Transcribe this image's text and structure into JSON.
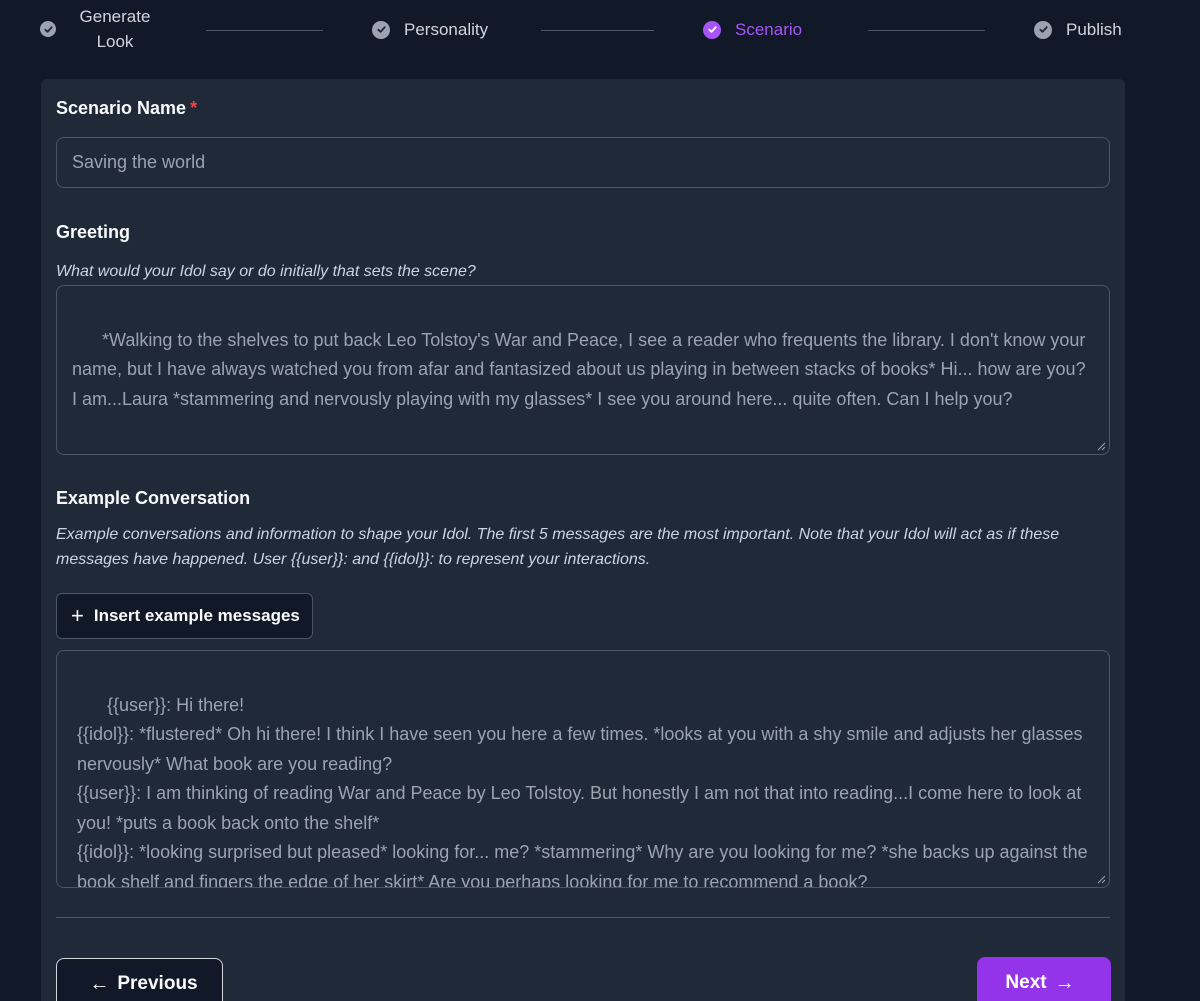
{
  "stepper": {
    "steps": [
      {
        "label": "Generate Look",
        "state": "completed"
      },
      {
        "label": "Personality",
        "state": "completed"
      },
      {
        "label": "Scenario",
        "state": "active"
      },
      {
        "label": "Publish",
        "state": "upcoming"
      }
    ]
  },
  "scenario_name": {
    "label": "Scenario Name",
    "required_marker": "*",
    "placeholder": "Saving the world"
  },
  "greeting": {
    "label": "Greeting",
    "hint": "What would your Idol say or do initially that sets the scene?",
    "placeholder": "*Walking to the shelves to put back Leo Tolstoy's War and Peace, I see a reader who frequents the library. I don't know your name, but I have always watched you from afar and fantasized about us playing in between stacks of books* Hi... how are you? I am...Laura *stammering and nervously playing with my glasses* I see you around here... quite often. Can I help you?"
  },
  "example_conversation": {
    "label": "Example Conversation",
    "hint": "Example conversations and information to shape your Idol. The first 5 messages are the most important. Note that your Idol will act as if these messages have happened. User {{user}}: and {{idol}}: to represent your interactions.",
    "insert_button": "Insert example messages",
    "placeholder": "{{user}}: Hi there!\n{{idol}}: *flustered* Oh hi there! I think I have seen you here a few times. *looks at you with a shy smile and adjusts her glasses nervously* What book are you reading?\n{{user}}: I am thinking of reading War and Peace by Leo Tolstoy. But honestly I am not that into reading...I come here to look at you! *puts a book back onto the shelf*\n{{idol}}: *looking surprised but pleased* looking for... me? *stammering* Why are you looking for me? *she backs up against the book shelf and fingers the edge of her skirt* Are you perhaps looking for me to recommend a book?"
  },
  "nav": {
    "previous": "Previous",
    "next": "Next"
  },
  "colors": {
    "accent": "#9333ea",
    "active_step": "#a855f7",
    "required": "#ef4444",
    "background": "#111827",
    "card": "#1f2937"
  }
}
